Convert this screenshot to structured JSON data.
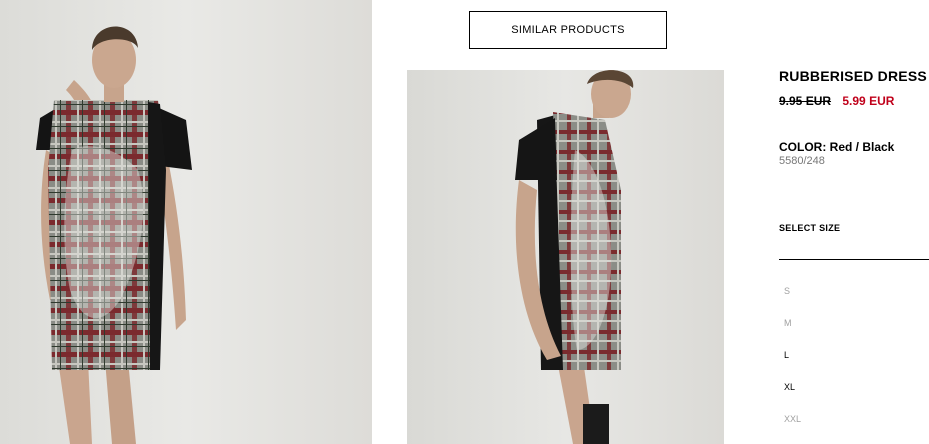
{
  "similar_products_label": "SIMILAR PRODUCTS",
  "product": {
    "title": "RUBBERISED DRESS",
    "price_old": "9.95 EUR",
    "price_new": "5.99 EUR",
    "color_label": "COLOR: Red / Black",
    "ref_code": "5580/248"
  },
  "size_selector": {
    "heading": "SELECT SIZE",
    "sizes": [
      {
        "label": "S",
        "available": false
      },
      {
        "label": "M",
        "available": false
      },
      {
        "label": "L",
        "available": true
      },
      {
        "label": "XL",
        "available": true
      },
      {
        "label": "XXL",
        "available": false
      }
    ]
  },
  "colors": {
    "sale_price": "#c0001a",
    "unavailable_size": "#a0a0a0"
  }
}
